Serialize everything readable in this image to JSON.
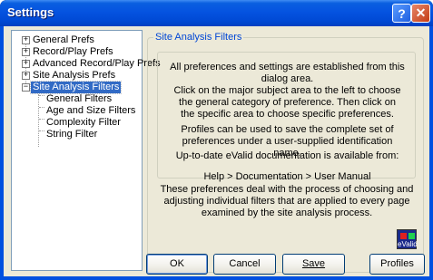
{
  "window": {
    "title": "Settings"
  },
  "tree": {
    "items": [
      {
        "label": "General Prefs"
      },
      {
        "label": "Record/Play Prefs"
      },
      {
        "label": "Advanced Record/Play Prefs"
      },
      {
        "label": "Site Analysis Prefs"
      },
      {
        "label": "Site Analysis Filters"
      },
      {
        "label": "General Filters"
      },
      {
        "label": "Age and Size Filters"
      },
      {
        "label": "Complexity Filter"
      },
      {
        "label": "String Filter"
      }
    ]
  },
  "panel": {
    "title": "Site Analysis Filters",
    "paragraphs": [
      "All preferences and settings are established from this dialog area.",
      "Click on the major subject area to the left to choose the general category of preference.  Then click on the specific area to choose specific preferences.",
      "Profiles can be used to save the complete set of preferences under a user-supplied identification name.",
      "Up-to-date eValid documentation is available from:",
      "Help > Documentation > User Manual"
    ],
    "description": "These preferences deal with the process of choosing and adjusting individual filters that are applied to every page examined by the site analysis process.",
    "logo_text": "eValid"
  },
  "buttons": {
    "ok": "OK",
    "cancel": "Cancel",
    "save": "Save",
    "profiles": "Profiles"
  }
}
